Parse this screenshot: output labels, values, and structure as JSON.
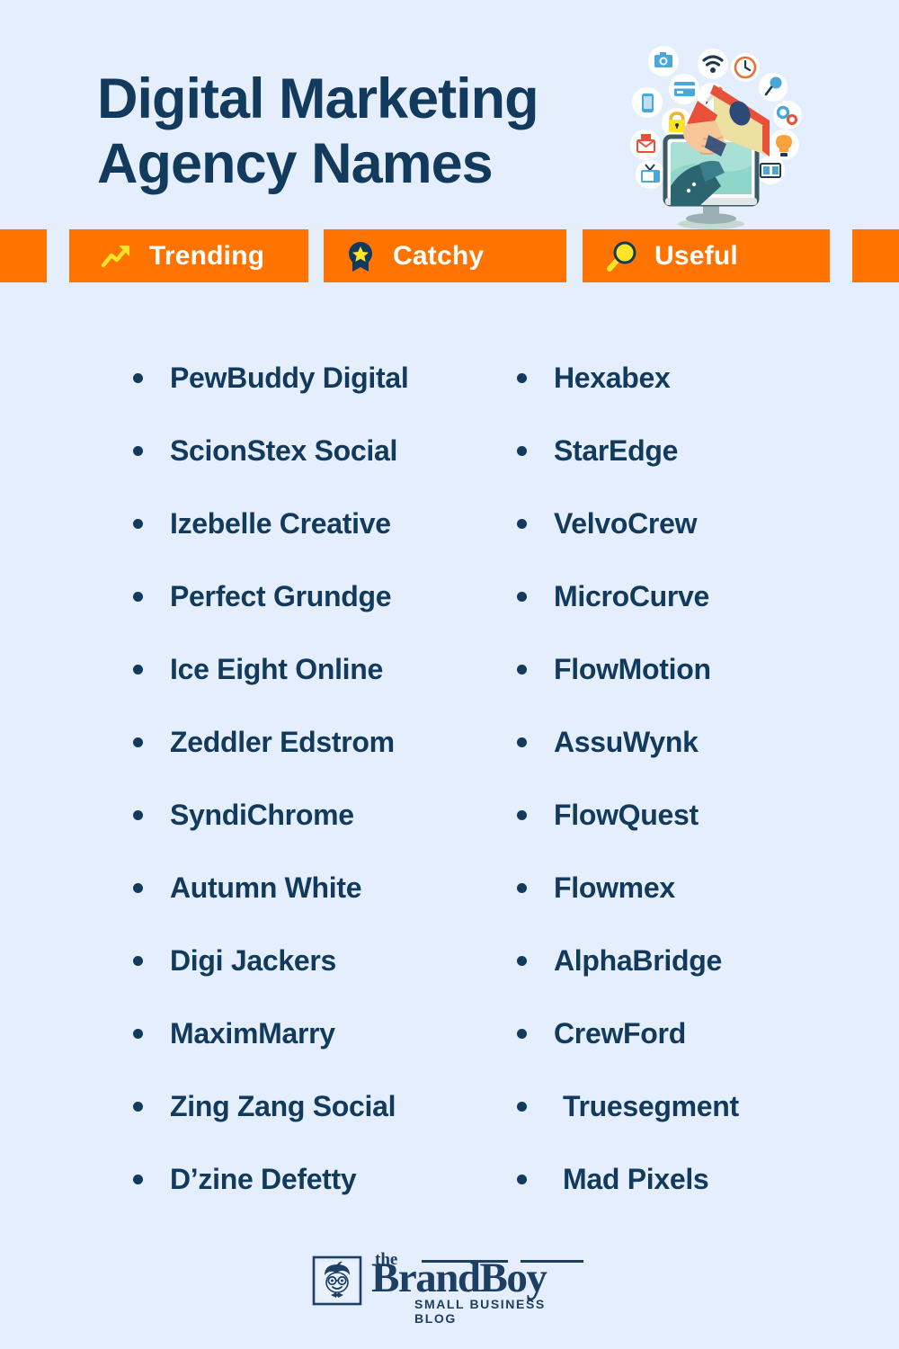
{
  "header": {
    "title_line1": "Digital Marketing",
    "title_line2": "Agency Names",
    "illustration_name": "megaphone-from-monitor-illustration"
  },
  "colors": {
    "background": "#e5eefd",
    "accent_orange": "#ff7300",
    "navy": "#123a5c",
    "yellow": "#fde428",
    "white": "#ffffff"
  },
  "badges": [
    {
      "label": "Trending",
      "icon": "trending-arrow-icon"
    },
    {
      "label": "Catchy",
      "icon": "ribbon-star-icon"
    },
    {
      "label": "Useful",
      "icon": "magnifier-icon"
    }
  ],
  "lists": {
    "left_column": [
      "PewBuddy Digital",
      "ScionStex Social",
      "Izebelle Creative",
      "Perfect Grundge",
      "Ice Eight Online",
      "Zeddler Edstrom",
      "SyndiChrome",
      "Autumn White",
      "Digi Jackers",
      "MaximMarry",
      "Zing Zang Social",
      "D’zine Defetty"
    ],
    "right_column": [
      "Hexabex",
      "StarEdge",
      "VelvoCrew",
      "MicroCurve",
      "FlowMotion",
      "AssuWynk",
      "FlowQuest",
      "Flowmex",
      "AlphaBridge",
      "CrewFord",
      "Truesegment",
      "Mad Pixels"
    ]
  },
  "footer": {
    "logo_the": "the",
    "logo_main": "BrandBoy",
    "logo_sub": "SMALL BUSINESS BLOG"
  }
}
